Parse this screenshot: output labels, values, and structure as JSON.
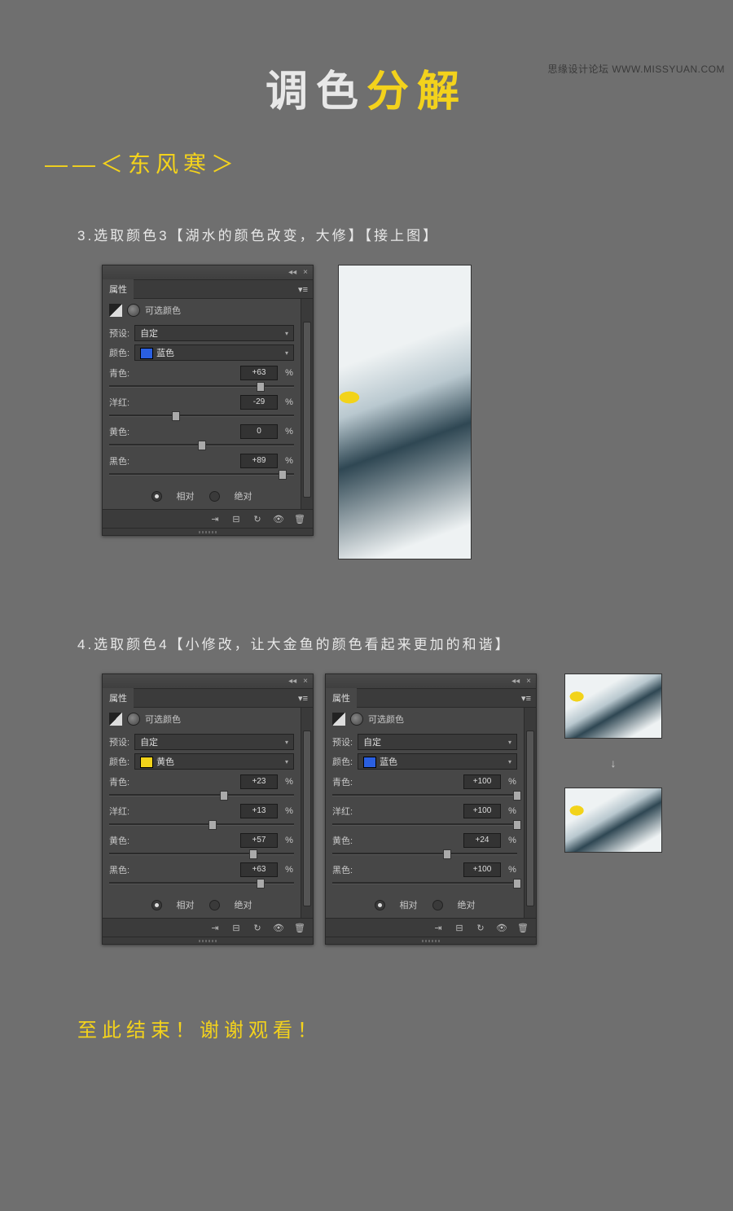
{
  "watermark": "思缘设计论坛  WWW.MISSYUAN.COM",
  "title": {
    "part1": "调色",
    "part2": "分解"
  },
  "subtitle": "——＜东风寒＞",
  "step3": "3.选取颜色3【湖水的颜色改变，大修】【接上图】",
  "step4": "4.选取颜色4【小修改，让大金鱼的颜色看起来更加的和谐】",
  "end": "至此结束！谢谢观看！",
  "arrow": "↓",
  "panel_common": {
    "tab": "属性",
    "adj_name": "可选颜色",
    "preset_label": "预设:",
    "preset_value": "自定",
    "color_label": "颜色:",
    "cyan": "青色:",
    "magenta": "洋红:",
    "yellow": "黄色:",
    "black": "黑色:",
    "pct": "%",
    "relative": "相对",
    "absolute": "绝对",
    "menu": "▾≡",
    "close": "×",
    "collapse": "◂◂"
  },
  "panels": {
    "p3": {
      "color_name": "蓝色",
      "swatch": "#2a5fe0",
      "cyan": "+63",
      "magenta": "-29",
      "yellow": "0",
      "black": "+89",
      "pos": {
        "cyan": 82,
        "magenta": 36,
        "yellow": 50,
        "black": 94
      }
    },
    "p4a": {
      "color_name": "黄色",
      "swatch": "#f2d31a",
      "cyan": "+23",
      "magenta": "+13",
      "yellow": "+57",
      "black": "+63",
      "pos": {
        "cyan": 62,
        "magenta": 56,
        "yellow": 78,
        "black": 82
      }
    },
    "p4b": {
      "color_name": "蓝色",
      "swatch": "#2a5fe0",
      "cyan": "+100",
      "magenta": "+100",
      "yellow": "+24",
      "black": "+100",
      "pos": {
        "cyan": 100,
        "magenta": 100,
        "yellow": 62,
        "black": 100
      }
    }
  }
}
